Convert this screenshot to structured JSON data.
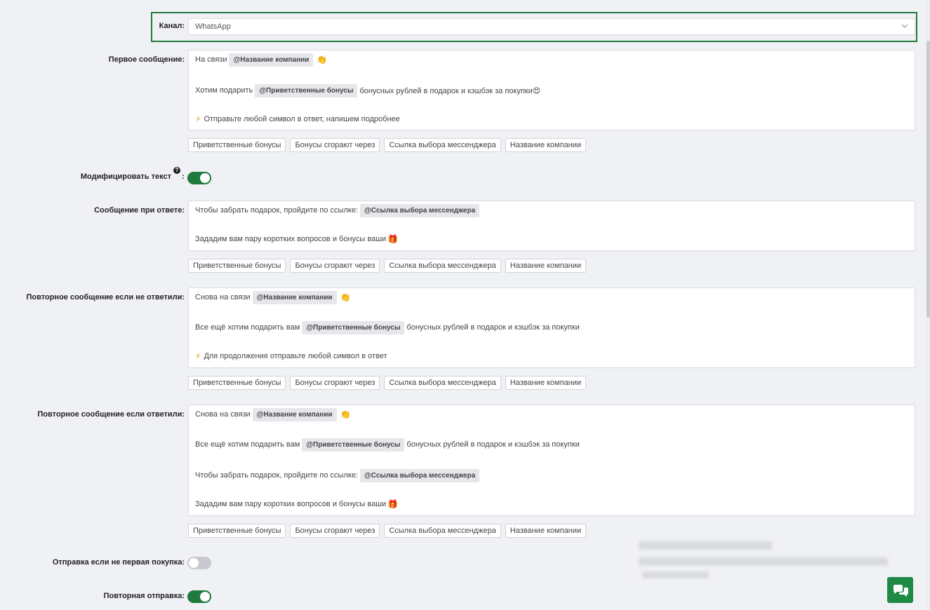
{
  "channel": {
    "label": "Канал:",
    "value": "WhatsApp"
  },
  "first_message": {
    "label": "Первое сообщение:",
    "line1_text": "На связи",
    "line1_tag": "@Название компании",
    "line1_emoji": "👏",
    "line2_pre": "Хотим подарить",
    "line2_tag": "@Приветственные бонусы",
    "line2_post": "бонусных рублей в подарок и кэшбэк за покупки😍",
    "line3_text": "Отправьте любой символ в ответ, напишем подробнее"
  },
  "chips": [
    "Приветственные бонусы",
    "Бонусы сгорают через",
    "Ссылка выбора мессенджера",
    "Название компании"
  ],
  "modify_text": {
    "label": "Модифицировать текст",
    "colon": ":",
    "help": "?",
    "state": "on"
  },
  "reply_message": {
    "label": "Сообщение при ответе:",
    "line1_text": "Чтобы забрать подарок, пройдите по ссылке:",
    "line1_tag": "@Ссылка выбора мессенджера",
    "line2_text": "Зададим вам пару коротких вопросов и бонусы ваши",
    "line2_emoji": "🎁"
  },
  "repeat_no_answer": {
    "label": "Повторное сообщение если не ответили:",
    "line1_text": "Снова на связи",
    "line1_tag": "@Название компании",
    "line1_emoji": "👏",
    "line2_pre": "Все ещё хотим подарить вам",
    "line2_tag": "@Приветственные бонусы",
    "line2_post": "бонусных рублей в подарок и кэшбэк за покупки",
    "line3_text": "Для продолжения отправьте любой символ в ответ"
  },
  "repeat_answered": {
    "label": "Повторное сообщение если ответили:",
    "line1_text": "Снова на связи",
    "line1_tag": "@Название компании",
    "line1_emoji": "👏",
    "line2_pre": "Все ещё хотим подарить вам",
    "line2_tag": "@Приветственные бонусы",
    "line2_post": "бонусных рублей в подарок и кэшбэк за покупки",
    "line3_text": "Чтобы забрать подарок, пройдите по ссылке:",
    "line3_tag": "@Ссылка выбора мессенджера",
    "line4_text": "Зададим вам пару коротких вопросов и бонусы ваши",
    "line4_emoji": "🎁"
  },
  "send_not_first": {
    "label": "Отправка если не первая покупка:",
    "state": "off"
  },
  "repeat_send": {
    "label": "Повторная отправка:",
    "state": "on"
  },
  "colors": {
    "accent": "#1f7a3d",
    "highlight_border": "#1e7a3f",
    "tag_bg": "#e6e7ea"
  },
  "icons": {
    "chat": "chat-bubbles-icon",
    "bolt": "lightning-icon",
    "chevron": "chevron-down-icon"
  }
}
